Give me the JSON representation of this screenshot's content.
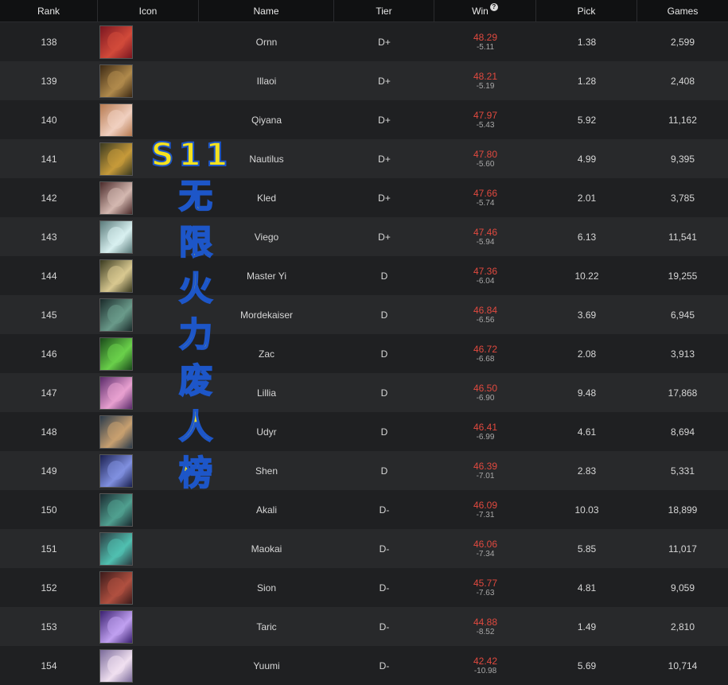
{
  "headers": {
    "rank": "Rank",
    "icon": "Icon",
    "name": "Name",
    "tier": "Tier",
    "win": "Win",
    "win_help": "?",
    "pick": "Pick",
    "games": "Games"
  },
  "colors": {
    "win_value": "#e0493f",
    "overlay_fill": "#f4e21f",
    "overlay_stroke": "#1d56c8"
  },
  "overlay": {
    "title": "S11",
    "chars": [
      "无",
      "限",
      "火",
      "力",
      "废",
      "人",
      "榜"
    ]
  },
  "rows": [
    {
      "rank": "138",
      "icon": "ornn-portrait",
      "name": "Ornn",
      "tier": "D+",
      "win": "48.29",
      "diff": "-5.11",
      "pick": "1.38",
      "games": "2,599",
      "c1": "#7a1620",
      "c2": "#d24a3a"
    },
    {
      "rank": "139",
      "icon": "illaoi-portrait",
      "name": "Illaoi",
      "tier": "D+",
      "win": "48.21",
      "diff": "-5.19",
      "pick": "1.28",
      "games": "2,408",
      "c1": "#3d2a14",
      "c2": "#b08a4c"
    },
    {
      "rank": "140",
      "icon": "qiyana-portrait",
      "name": "Qiyana",
      "tier": "D+",
      "win": "47.97",
      "diff": "-5.43",
      "pick": "5.92",
      "games": "11,162",
      "c1": "#b77a50",
      "c2": "#f0d0c0"
    },
    {
      "rank": "141",
      "icon": "nautilus-portrait",
      "name": "Nautilus",
      "tier": "D+",
      "win": "47.80",
      "diff": "-5.60",
      "pick": "4.99",
      "games": "9,395",
      "c1": "#3a3a20",
      "c2": "#c69a3a"
    },
    {
      "rank": "142",
      "icon": "kled-portrait",
      "name": "Kled",
      "tier": "D+",
      "win": "47.66",
      "diff": "-5.74",
      "pick": "2.01",
      "games": "3,785",
      "c1": "#4a2a2a",
      "c2": "#d4b8b0"
    },
    {
      "rank": "143",
      "icon": "viego-portrait",
      "name": "Viego",
      "tier": "D+",
      "win": "47.46",
      "diff": "-5.94",
      "pick": "6.13",
      "games": "11,541",
      "c1": "#5a7a7a",
      "c2": "#d8f0f0"
    },
    {
      "rank": "144",
      "icon": "master-yi-portrait",
      "name": "Master Yi",
      "tier": "D",
      "win": "47.36",
      "diff": "-6.04",
      "pick": "10.22",
      "games": "19,255",
      "c1": "#3a3a20",
      "c2": "#d8c890"
    },
    {
      "rank": "145",
      "icon": "mordekaiser-portrait",
      "name": "Mordekaiser",
      "tier": "D",
      "win": "46.84",
      "diff": "-6.56",
      "pick": "3.69",
      "games": "6,945",
      "c1": "#1a2a2a",
      "c2": "#6a9a8a"
    },
    {
      "rank": "146",
      "icon": "zac-portrait",
      "name": "Zac",
      "tier": "D",
      "win": "46.72",
      "diff": "-6.68",
      "pick": "2.08",
      "games": "3,913",
      "c1": "#1a4a1a",
      "c2": "#6ad04a"
    },
    {
      "rank": "147",
      "icon": "lillia-portrait",
      "name": "Lillia",
      "tier": "D",
      "win": "46.50",
      "diff": "-6.90",
      "pick": "9.48",
      "games": "17,868",
      "c1": "#5a2a6a",
      "c2": "#e8a0d0"
    },
    {
      "rank": "148",
      "icon": "udyr-portrait",
      "name": "Udyr",
      "tier": "D",
      "win": "46.41",
      "diff": "-6.99",
      "pick": "4.61",
      "games": "8,694",
      "c1": "#2a3a4a",
      "c2": "#c8a070"
    },
    {
      "rank": "149",
      "icon": "shen-portrait",
      "name": "Shen",
      "tier": "D",
      "win": "46.39",
      "diff": "-7.01",
      "pick": "2.83",
      "games": "5,331",
      "c1": "#1a2050",
      "c2": "#8090e0"
    },
    {
      "rank": "150",
      "icon": "akali-portrait",
      "name": "Akali",
      "tier": "D-",
      "win": "46.09",
      "diff": "-7.31",
      "pick": "10.03",
      "games": "18,899",
      "c1": "#1a2a30",
      "c2": "#50a090"
    },
    {
      "rank": "151",
      "icon": "maokai-portrait",
      "name": "Maokai",
      "tier": "D-",
      "win": "46.06",
      "diff": "-7.34",
      "pick": "5.85",
      "games": "11,017",
      "c1": "#2a3a40",
      "c2": "#50c0b0"
    },
    {
      "rank": "152",
      "icon": "sion-portrait",
      "name": "Sion",
      "tier": "D-",
      "win": "45.77",
      "diff": "-7.63",
      "pick": "4.81",
      "games": "9,059",
      "c1": "#3a1a1a",
      "c2": "#b05040"
    },
    {
      "rank": "153",
      "icon": "taric-portrait",
      "name": "Taric",
      "tier": "D-",
      "win": "44.88",
      "diff": "-8.52",
      "pick": "1.49",
      "games": "2,810",
      "c1": "#3a2070",
      "c2": "#c0a0f0"
    },
    {
      "rank": "154",
      "icon": "yuumi-portrait",
      "name": "Yuumi",
      "tier": "D-",
      "win": "42.42",
      "diff": "-10.98",
      "pick": "5.69",
      "games": "10,714",
      "c1": "#7a6a9a",
      "c2": "#f0e0f0"
    }
  ]
}
